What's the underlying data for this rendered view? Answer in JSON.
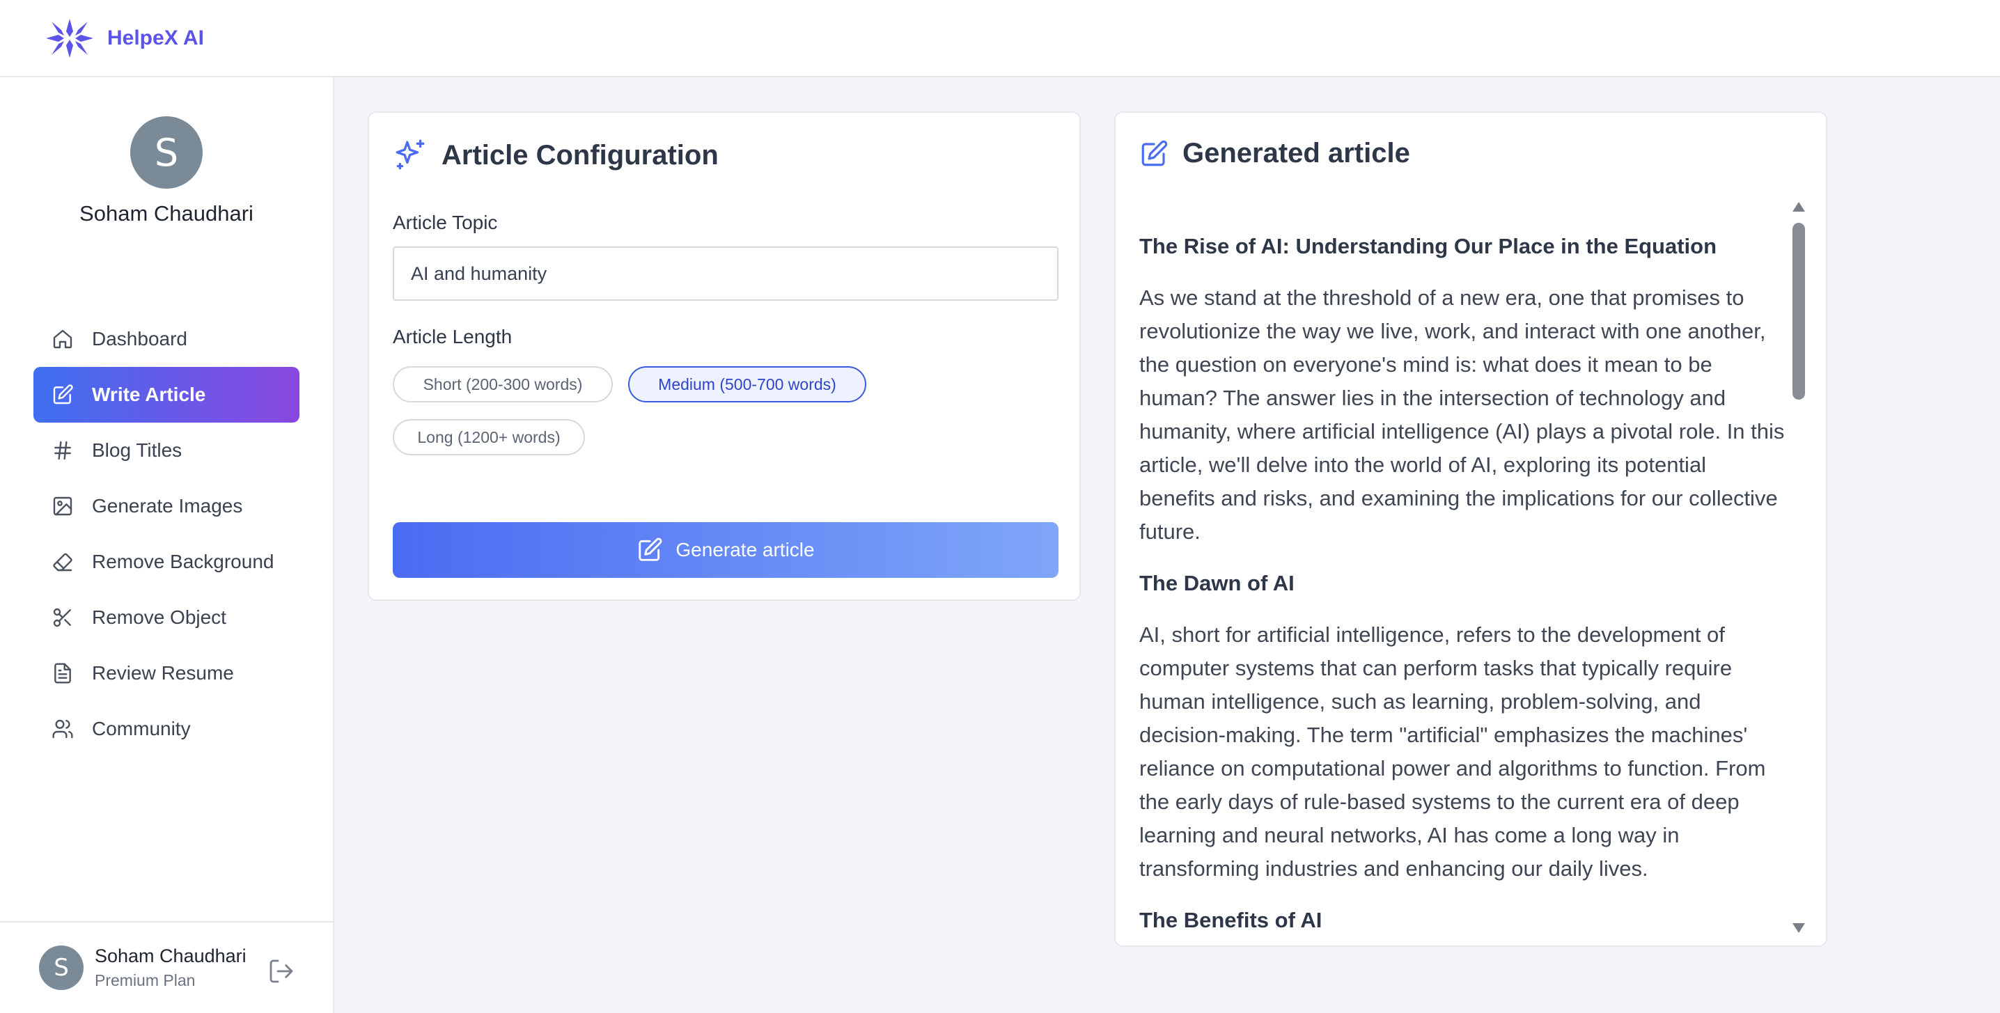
{
  "app": {
    "logo_icon": "snowflake-logo-icon",
    "brand_name": "HelpeX AI",
    "brand_color": "#5b54e6"
  },
  "sidebar": {
    "user": {
      "initial": "S",
      "name": "Soham Chaudhari"
    },
    "items": [
      {
        "label": "Dashboard",
        "icon": "home-icon",
        "active": false
      },
      {
        "label": "Write Article",
        "icon": "edit-icon",
        "active": true
      },
      {
        "label": "Blog Titles",
        "icon": "hash-icon",
        "active": false
      },
      {
        "label": "Generate Images",
        "icon": "image-icon",
        "active": false
      },
      {
        "label": "Remove Background",
        "icon": "eraser-icon",
        "active": false
      },
      {
        "label": "Remove Object",
        "icon": "scissors-icon",
        "active": false
      },
      {
        "label": "Review Resume",
        "icon": "file-text-icon",
        "active": false
      },
      {
        "label": "Community",
        "icon": "users-icon",
        "active": false
      }
    ],
    "footer": {
      "initial": "S",
      "name": "Soham Chaudhari",
      "plan": "Premium Plan",
      "logout_icon": "logout-icon"
    }
  },
  "config": {
    "title": "Article Configuration",
    "icon": "sparkles-icon",
    "topic_label": "Article Topic",
    "topic_value": "AI and humanity",
    "length_label": "Article Length",
    "length_options": [
      {
        "label": "Short (200-300 words)",
        "selected": false
      },
      {
        "label": "Medium (500-700 words)",
        "selected": true
      },
      {
        "label": "Long (1200+ words)",
        "selected": false
      }
    ],
    "generate_label": "Generate article",
    "generate_icon": "edit-icon"
  },
  "output": {
    "title": "Generated article",
    "icon": "edit-icon",
    "article": {
      "heading": "The Rise of AI: Understanding Our Place in the Equation",
      "intro": "As we stand at the threshold of a new era, one that promises to revolutionize the way we live, work, and interact with one another, the question on everyone's mind is: what does it mean to be human? The answer lies in the intersection of technology and humanity, where artificial intelligence (AI) plays a pivotal role. In this article, we'll delve into the world of AI, exploring its potential benefits and risks, and examining the implications for our collective future.",
      "section1_heading": "The Dawn of AI",
      "section1_body": "AI, short for artificial intelligence, refers to the development of computer systems that can perform tasks that typically require human intelligence, such as learning, problem-solving, and decision-making. The term \"artificial\" emphasizes the machines' reliance on computational power and algorithms to function. From the early days of rule-based systems to the current era of deep learning and neural networks, AI has come a long way in transforming industries and enhancing our daily lives.",
      "section2_heading": "The Benefits of AI"
    }
  }
}
